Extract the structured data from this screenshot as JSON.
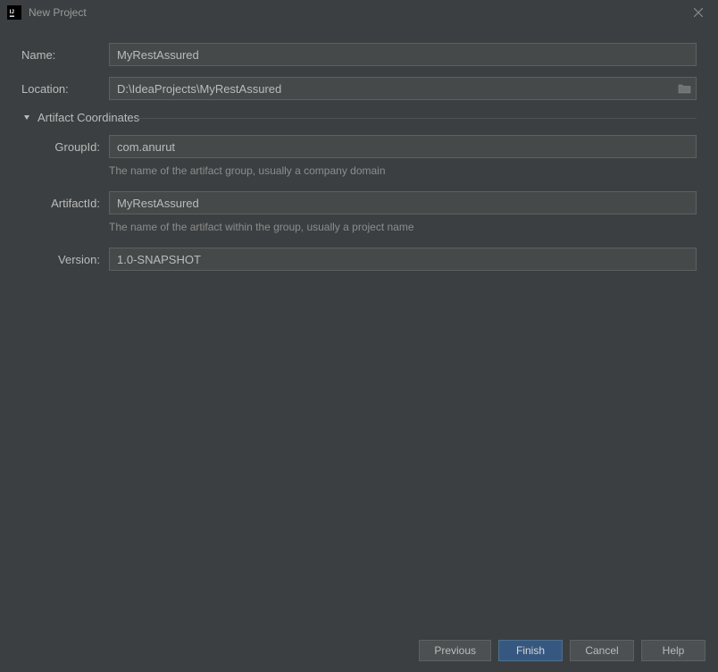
{
  "window": {
    "title": "New Project"
  },
  "fields": {
    "name": {
      "label": "Name:",
      "value": "MyRestAssured"
    },
    "location": {
      "label": "Location:",
      "value": "D:\\IdeaProjects\\MyRestAssured"
    }
  },
  "section": {
    "title": "Artifact Coordinates"
  },
  "artifact": {
    "groupId": {
      "label": "GroupId:",
      "value": "com.anurut",
      "hint": "The name of the artifact group, usually a company domain"
    },
    "artifactId": {
      "label": "ArtifactId:",
      "value": "MyRestAssured",
      "hint": "The name of the artifact within the group, usually a project name"
    },
    "version": {
      "label": "Version:",
      "value": "1.0-SNAPSHOT"
    }
  },
  "buttons": {
    "previous": "Previous",
    "finish": "Finish",
    "cancel": "Cancel",
    "help": "Help"
  }
}
